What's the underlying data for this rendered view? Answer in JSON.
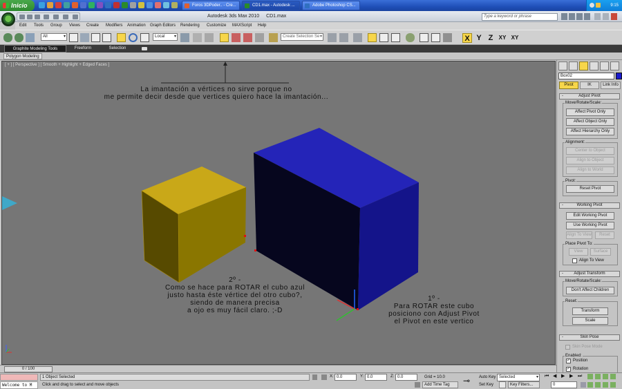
{
  "taskbar": {
    "start_label": "Inicio",
    "tasks": [
      {
        "label": "Foros 3DPoder.. - Cre..."
      },
      {
        "label": "CD1.max - Autodesk ..."
      },
      {
        "label": "Adobe Photoshop CS..."
      }
    ],
    "clock": "9:15"
  },
  "title_bar": {
    "app_name": "Autodesk 3ds Max  2010",
    "file_name": "CD1.max",
    "search_placeholder": "Type a keyword or phrase"
  },
  "menu": [
    "Edit",
    "Tools",
    "Group",
    "Views",
    "Create",
    "Modifiers",
    "Animation",
    "Graph Editors",
    "Rendering",
    "Customize",
    "MAXScript",
    "Help"
  ],
  "toolbar": {
    "filter_value": "All",
    "coord_system": "Local",
    "selection_set_placeholder": "Create Selection Se",
    "axes": [
      "X",
      "Y",
      "Z",
      "XY",
      "XY"
    ]
  },
  "ribbon": {
    "tabs": [
      "Graphite Modeling Tools",
      "Freeform",
      "Selection"
    ],
    "subtab": "Polygon Modeling"
  },
  "viewport": {
    "label": "[ + ] [ Perspective ] [ Smooth + Highlight + Edged Faces ]",
    "notes": {
      "top": [
        "La imantación a vértices no sirve porque no",
        "me permite decir desde que vertices quiero hace la imantación..."
      ],
      "middle": [
        "2º -",
        "Como se hace para ROTAR el cubo azul",
        "justo hasta éste vértice del otro cubo?,",
        "siendo de manera precisa",
        "a ojo es muy fácil claro. ;-D"
      ],
      "right": [
        "1º -",
        "Para ROTAR este cubo",
        "posiciono con Adjust Pivot",
        "el Pivot en este vertico"
      ]
    },
    "colors": {
      "yellow_cube": "#8a7800",
      "blue_cube": "#14148a",
      "background": "#767676"
    }
  },
  "command_panel": {
    "object_name": "Box02",
    "object_color": "#1a1acc",
    "subtabs": [
      "Pivot",
      "IK",
      "Link Info"
    ],
    "adjust_pivot": {
      "title": "Adjust Pivot",
      "group_move": "Move/Rotate/Scale:",
      "buttons": [
        "Affect Pivot Only",
        "Affect Object Only",
        "Affect Hierarchy Only"
      ],
      "group_align": "Alignment:",
      "align_buttons": [
        "Center to Object",
        "Align to Object",
        "Align to World"
      ],
      "group_pivot": "Pivot:",
      "reset_pivot": "Reset Pivot"
    },
    "working_pivot": {
      "title": "Working Pivot",
      "buttons": [
        "Edit Working Pivot",
        "Use Working Pivot"
      ],
      "align_to_view": "Align To View",
      "reset": "Reset",
      "place_group": "Place Pivot To:",
      "view": "View",
      "surface": "Surface",
      "align_to_view_chk": "Align To View"
    },
    "adjust_transform": {
      "title": "Adjust Transform",
      "group_move": "Move/Rotate/Scale:",
      "dont_affect": "Don't Affect Children",
      "group_reset": "Reset:",
      "transform": "Transform",
      "scale": "Scale"
    },
    "skin_pose": {
      "title": "Skin Pose",
      "mode": "Skin Pose Mode",
      "enabled": "Enabled:",
      "position": "Position",
      "rotation": "Rotation"
    }
  },
  "time_slider": {
    "value": "0 / 100"
  },
  "status": {
    "listener": "Welcome to M",
    "selected": "1 Object Selected",
    "prompt": "Click and drag to select and move objects",
    "x_label": "X:",
    "x": "0.0",
    "y_label": "Y:",
    "y": "0.0",
    "z_label": "Z:",
    "z": "0.0",
    "grid": "Grid = 10.0",
    "add_time_tag": "Add Time Tag",
    "auto_key": "Auto Key",
    "set_key": "Set Key",
    "key_mode": "Selected",
    "key_filters": "Key Filters...",
    "frame": "0"
  }
}
